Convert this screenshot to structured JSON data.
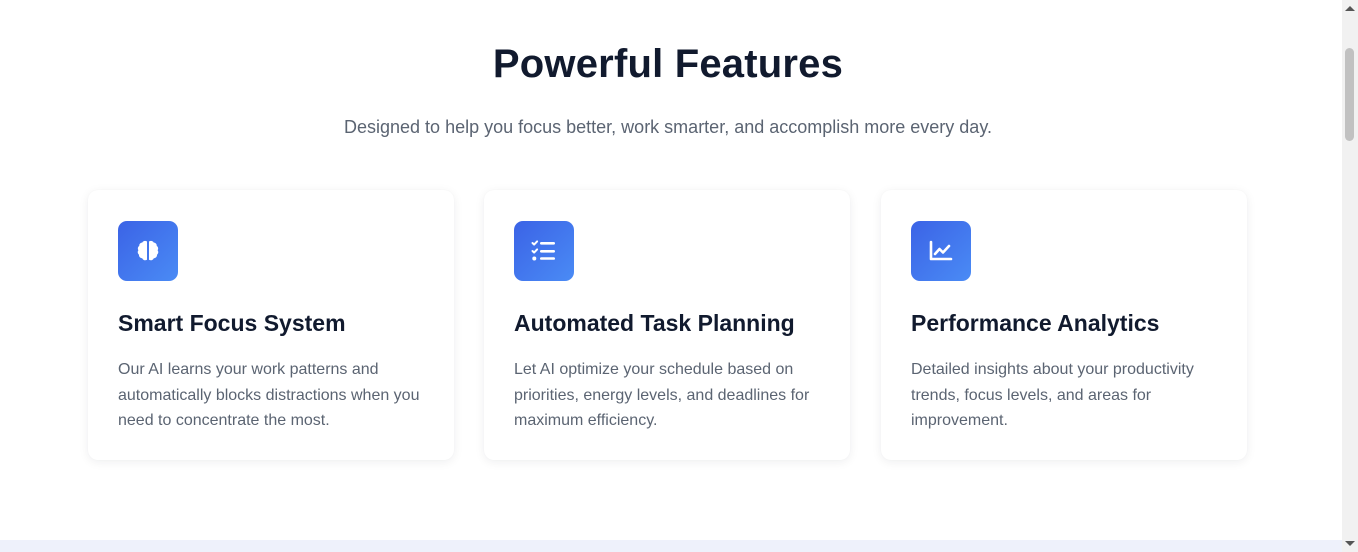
{
  "features": {
    "title": "Powerful Features",
    "subtitle": "Designed to help you focus better, work smarter, and accomplish more every day.",
    "cards": [
      {
        "icon": "brain-icon",
        "title": "Smart Focus System",
        "text": "Our AI learns your work patterns and automatically blocks distractions when you need to concentrate the most."
      },
      {
        "icon": "task-list-icon",
        "title": "Automated Task Planning",
        "text": "Let AI optimize your schedule based on priorities, energy levels, and deadlines for maximum efficiency."
      },
      {
        "icon": "line-chart-icon",
        "title": "Performance Analytics",
        "text": "Detailed insights about your productivity trends, focus levels, and areas for improvement."
      }
    ]
  },
  "colors": {
    "heading": "#111a2e",
    "body_text": "#5b6472",
    "icon_gradient_start": "#3b63e6",
    "icon_gradient_end": "#4a8bf5"
  }
}
